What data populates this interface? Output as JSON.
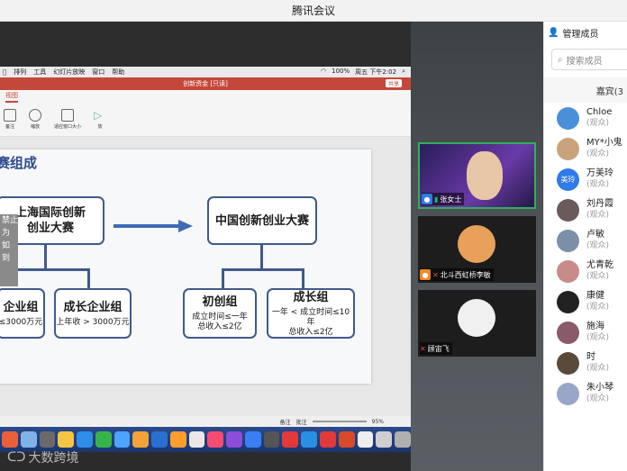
{
  "window": {
    "title": "腾讯会议"
  },
  "mac_menubar": {
    "items": [
      "排列",
      "工具",
      "幻灯片放映",
      "窗口",
      "帮助"
    ],
    "status": [
      "100%",
      "周五 下午2:02"
    ]
  },
  "ppt": {
    "doc_title": "创新资金 [只读]",
    "share_label": "共享",
    "tab_active": "视图",
    "ribbon": [
      "备注",
      "缩放",
      "适应窗口大小",
      "放"
    ],
    "status": {
      "notes": "备注",
      "comments": "批注",
      "zoom": "95%"
    }
  },
  "slide": {
    "title": "赛组成",
    "overlay_text": [
      "禁止",
      "为",
      "如",
      "到"
    ],
    "left_top": {
      "title_line1": "上海国际创新",
      "title_line2": "创业大赛"
    },
    "right_top": {
      "title": "中国创新创业大赛"
    },
    "left_a": {
      "title": "企业组",
      "sub": "≤3000万元"
    },
    "left_b": {
      "title": "成长企业组",
      "sub": "上年收 > 3000万元"
    },
    "right_a": {
      "title": "初创组",
      "sub1": "成立时间≤一年",
      "sub2": "总收入≤2亿"
    },
    "right_b": {
      "title": "成长组",
      "sub1": "一年 < 成立时间≤10年",
      "sub2": "总收入≤2亿"
    }
  },
  "watermark": "大数跨境",
  "videos": [
    {
      "name": "张女士",
      "bg": "#3b2a6b"
    },
    {
      "name": "北斗西虹桥李敏",
      "bg": "#2a2a2a"
    },
    {
      "name": "顾宙飞",
      "bg": "#2a2a2a"
    }
  ],
  "panel": {
    "title": "管理成员",
    "search_placeholder": "搜索成员",
    "section": "嘉宾(3",
    "members": [
      {
        "name": "Chloe",
        "role": "(观众)",
        "color": "#4a90d9",
        "initial": ""
      },
      {
        "name": "MY*小鬼",
        "role": "(观众)",
        "color": "#c9a27e",
        "initial": ""
      },
      {
        "name": "万美玲",
        "role": "(观众)",
        "color": "#2f7be8",
        "initial": "美玲"
      },
      {
        "name": "刘丹霞",
        "role": "(观众)",
        "color": "#6a5a5a",
        "initial": ""
      },
      {
        "name": "卢敏",
        "role": "(观众)",
        "color": "#7a8fa8",
        "initial": ""
      },
      {
        "name": "尤青乾",
        "role": "(观众)",
        "color": "#c98a8a",
        "initial": ""
      },
      {
        "name": "康健",
        "role": "(观众)",
        "color": "#222222",
        "initial": ""
      },
      {
        "name": "施海",
        "role": "(观众)",
        "color": "#8a5a6a",
        "initial": ""
      },
      {
        "name": "时",
        "role": "(观众)",
        "color": "#5a4a3a",
        "initial": ""
      },
      {
        "name": "朱小琴",
        "role": "(观众)",
        "color": "#9aa6c8",
        "initial": ""
      }
    ]
  }
}
